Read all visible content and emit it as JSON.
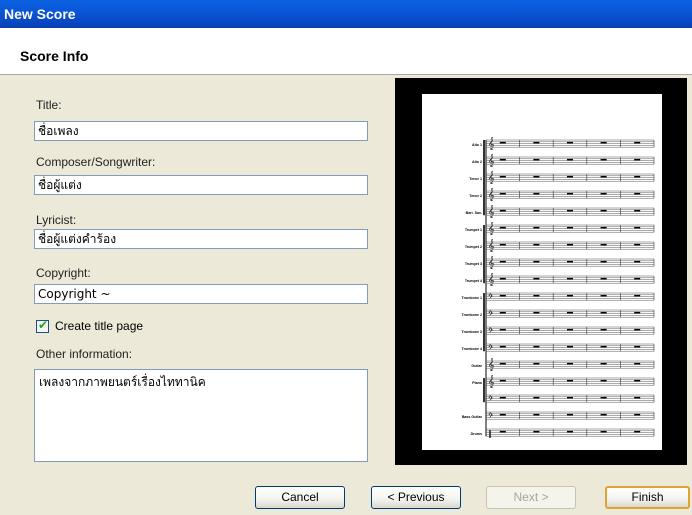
{
  "window": {
    "title": "New Score"
  },
  "header": {
    "title": "Score Info"
  },
  "form": {
    "title_label": "Title:",
    "title_value": "ชื่อเพลง",
    "composer_label": "Composer/Songwriter:",
    "composer_value": "ชื่อผู้แต่ง",
    "lyricist_label": "Lyricist:",
    "lyricist_value": "ชื่อผู้แต่งคำร้อง",
    "copyright_label": "Copyright:",
    "copyright_value": "Copyright ~",
    "create_title_page_label": "Create title page",
    "create_title_page_checked": true,
    "other_info_label": "Other information:",
    "other_info_value": "เพลงจากภาพยนตร์เรื่องไททานิค"
  },
  "buttons": {
    "cancel": "Cancel",
    "previous": "< Previous",
    "next": "Next >",
    "finish": "Finish"
  },
  "preview": {
    "measures_per_staff": 5,
    "staves": [
      {
        "name": "Alto 1",
        "clef": "treble",
        "group": "sax"
      },
      {
        "name": "Alto 2",
        "clef": "treble",
        "group": "sax"
      },
      {
        "name": "Tenor 1",
        "clef": "treble",
        "group": "sax"
      },
      {
        "name": "Tenor 2",
        "clef": "treble",
        "group": "sax"
      },
      {
        "name": "Bari. Sax.",
        "clef": "treble",
        "group": "sax"
      },
      {
        "name": "Trumpet 1",
        "clef": "treble",
        "group": "trumpet"
      },
      {
        "name": "Trumpet 2",
        "clef": "treble",
        "group": "trumpet"
      },
      {
        "name": "Trumpet 3",
        "clef": "treble",
        "group": "trumpet"
      },
      {
        "name": "Trumpet 4",
        "clef": "treble",
        "group": "trumpet"
      },
      {
        "name": "Trombone 1",
        "clef": "bass",
        "group": "trombone"
      },
      {
        "name": "Trombone 2",
        "clef": "bass",
        "group": "trombone"
      },
      {
        "name": "Trombone 3",
        "clef": "bass",
        "group": "trombone"
      },
      {
        "name": "Trombone 4",
        "clef": "bass",
        "group": "trombone"
      },
      {
        "name": "Guitar",
        "clef": "treble",
        "group": "guitar"
      },
      {
        "name": "Piano",
        "clef": "treble",
        "group": "piano"
      },
      {
        "name": "",
        "clef": "bass",
        "group": "piano"
      },
      {
        "name": "Bass Guitar",
        "clef": "bass",
        "group": "bass"
      },
      {
        "name": "Drums",
        "clef": "perc",
        "group": "drums"
      }
    ]
  }
}
